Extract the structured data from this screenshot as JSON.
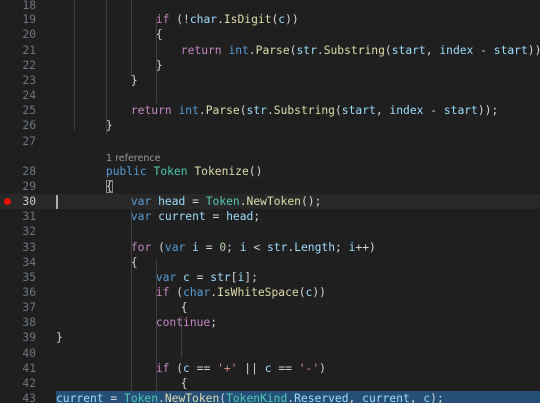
{
  "editor": {
    "codelens": "1 reference",
    "breakpoint_line": 30,
    "lines": [
      {
        "n": "18",
        "tokens": []
      },
      {
        "n": "19",
        "tokens": [
          [
            "ctrl",
            "if"
          ],
          [
            "p",
            " (!"
          ],
          [
            "var",
            "char"
          ],
          [
            "p",
            "."
          ],
          [
            "fn",
            "IsDigit"
          ],
          [
            "p",
            "("
          ],
          [
            "var",
            "c"
          ],
          [
            "p",
            "))"
          ]
        ]
      },
      {
        "n": "20",
        "tokens": [
          [
            "p",
            "{"
          ]
        ]
      },
      {
        "n": "21",
        "tokens": [
          [
            "ctrl",
            "return"
          ],
          [
            "p",
            " "
          ],
          [
            "kw",
            "int"
          ],
          [
            "p",
            "."
          ],
          [
            "fn",
            "Parse"
          ],
          [
            "p",
            "("
          ],
          [
            "var",
            "str"
          ],
          [
            "p",
            "."
          ],
          [
            "fn",
            "Substring"
          ],
          [
            "p",
            "("
          ],
          [
            "var",
            "start"
          ],
          [
            "p",
            ", "
          ],
          [
            "var",
            "index"
          ],
          [
            "p",
            " - "
          ],
          [
            "var",
            "start"
          ],
          [
            "p",
            "));"
          ]
        ]
      },
      {
        "n": "22",
        "tokens": [
          [
            "p",
            "}"
          ]
        ]
      },
      {
        "n": "23",
        "tokens": [
          [
            "p",
            "}"
          ]
        ]
      },
      {
        "n": "24",
        "tokens": []
      },
      {
        "n": "25",
        "tokens": [
          [
            "ctrl",
            "return"
          ],
          [
            "p",
            " "
          ],
          [
            "kw",
            "int"
          ],
          [
            "p",
            "."
          ],
          [
            "fn",
            "Parse"
          ],
          [
            "p",
            "("
          ],
          [
            "var",
            "str"
          ],
          [
            "p",
            "."
          ],
          [
            "fn",
            "Substring"
          ],
          [
            "p",
            "("
          ],
          [
            "var",
            "start"
          ],
          [
            "p",
            ", "
          ],
          [
            "var",
            "index"
          ],
          [
            "p",
            " - "
          ],
          [
            "var",
            "start"
          ],
          [
            "p",
            "));"
          ]
        ]
      },
      {
        "n": "26",
        "tokens": [
          [
            "p",
            "}"
          ]
        ]
      },
      {
        "n": "27",
        "tokens": []
      },
      {
        "n": "28",
        "tokens": [
          [
            "kw",
            "public"
          ],
          [
            "p",
            " "
          ],
          [
            "ty",
            "Token"
          ],
          [
            "p",
            " "
          ],
          [
            "fn",
            "Tokenize"
          ],
          [
            "p",
            "()"
          ]
        ]
      },
      {
        "n": "29",
        "tokens": [
          [
            "p",
            "{"
          ]
        ]
      },
      {
        "n": "30",
        "tokens": [
          [
            "kw",
            "var"
          ],
          [
            "p",
            " "
          ],
          [
            "var",
            "head"
          ],
          [
            "p",
            " = "
          ],
          [
            "ty",
            "Token"
          ],
          [
            "p",
            "."
          ],
          [
            "fn",
            "NewToken"
          ],
          [
            "p",
            "();"
          ]
        ]
      },
      {
        "n": "31",
        "tokens": [
          [
            "kw",
            "var"
          ],
          [
            "p",
            " "
          ],
          [
            "var",
            "current"
          ],
          [
            "p",
            " = "
          ],
          [
            "var",
            "head"
          ],
          [
            "p",
            ";"
          ]
        ]
      },
      {
        "n": "32",
        "tokens": []
      },
      {
        "n": "33",
        "tokens": [
          [
            "ctrl",
            "for"
          ],
          [
            "p",
            " ("
          ],
          [
            "kw",
            "var"
          ],
          [
            "p",
            " "
          ],
          [
            "var",
            "i"
          ],
          [
            "p",
            " = "
          ],
          [
            "num",
            "0"
          ],
          [
            "p",
            "; "
          ],
          [
            "var",
            "i"
          ],
          [
            "p",
            " < "
          ],
          [
            "var",
            "str"
          ],
          [
            "p",
            "."
          ],
          [
            "var",
            "Length"
          ],
          [
            "p",
            "; "
          ],
          [
            "var",
            "i"
          ],
          [
            "p",
            "++)"
          ]
        ]
      },
      {
        "n": "34",
        "tokens": [
          [
            "p",
            "{"
          ]
        ]
      },
      {
        "n": "35",
        "tokens": [
          [
            "kw",
            "var"
          ],
          [
            "p",
            " "
          ],
          [
            "var",
            "c"
          ],
          [
            "p",
            " = "
          ],
          [
            "var",
            "str"
          ],
          [
            "p",
            "["
          ],
          [
            "var",
            "i"
          ],
          [
            "p",
            "];"
          ]
        ]
      },
      {
        "n": "36",
        "tokens": [
          [
            "ctrl",
            "if"
          ],
          [
            "p",
            " ("
          ],
          [
            "kw",
            "char"
          ],
          [
            "p",
            "."
          ],
          [
            "fn",
            "IsWhiteSpace"
          ],
          [
            "p",
            "("
          ],
          [
            "var",
            "c"
          ],
          [
            "p",
            "))"
          ]
        ]
      },
      {
        "n": "37",
        "tokens": [
          [
            "p",
            "{"
          ]
        ]
      },
      {
        "n": "38",
        "tokens": [
          [
            "ctrl",
            "continue"
          ],
          [
            "p",
            ";"
          ]
        ]
      },
      {
        "n": "39",
        "tokens": [
          [
            "p",
            "}"
          ]
        ]
      },
      {
        "n": "40",
        "tokens": []
      },
      {
        "n": "41",
        "tokens": [
          [
            "ctrl",
            "if"
          ],
          [
            "p",
            " ("
          ],
          [
            "var",
            "c"
          ],
          [
            "p",
            " == "
          ],
          [
            "str",
            "'+'"
          ],
          [
            "p",
            " || "
          ],
          [
            "var",
            "c"
          ],
          [
            "p",
            " == "
          ],
          [
            "str",
            "'-'"
          ],
          [
            "p",
            ")"
          ]
        ]
      },
      {
        "n": "42",
        "tokens": [
          [
            "p",
            "{"
          ]
        ]
      },
      {
        "n": "43",
        "tokens": [
          [
            "var",
            "current"
          ],
          [
            "p",
            " = "
          ],
          [
            "ty",
            "Token"
          ],
          [
            "p",
            "."
          ],
          [
            "fn",
            "NewToken"
          ],
          [
            "p",
            "("
          ],
          [
            "ty",
            "TokenKind"
          ],
          [
            "p",
            "."
          ],
          [
            "var",
            "Reserved"
          ],
          [
            "p",
            ", "
          ],
          [
            "var",
            "current"
          ],
          [
            "p",
            ", "
          ],
          [
            "var",
            "c"
          ],
          [
            "p",
            ");"
          ]
        ]
      }
    ]
  }
}
